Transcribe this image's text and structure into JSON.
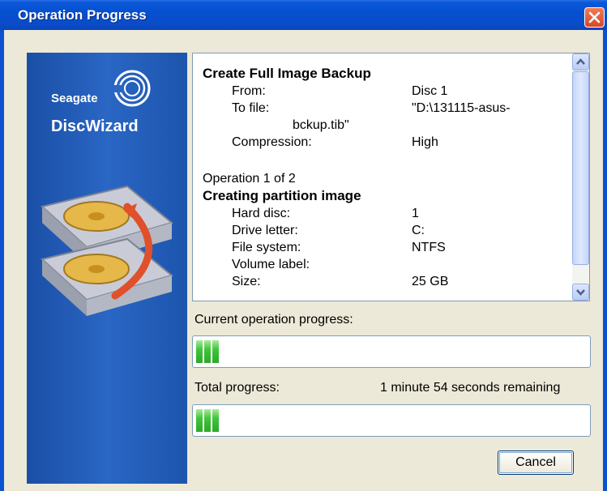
{
  "window": {
    "title": "Operation Progress"
  },
  "banner": {
    "brand": "Seagate",
    "product": "DiscWizard"
  },
  "details": {
    "heading": "Create Full Image Backup",
    "from_label": "From:",
    "from_value": "Disc 1",
    "tofile_label": "To file:",
    "tofile_value": "\"D:\\131115-asus-",
    "tofile_value_cont": "bckup.tib\"",
    "compression_label": "Compression:",
    "compression_value": "High",
    "operation": "Operation 1 of 2",
    "subheading": "Creating partition image",
    "harddisc_label": "Hard disc:",
    "harddisc_value": "1",
    "driveletter_label": "Drive letter:",
    "driveletter_value": "C:",
    "filesystem_label": "File system:",
    "filesystem_value": "NTFS",
    "volumelabel_label": "Volume label:",
    "size_label": "Size:",
    "size_value": "25 GB"
  },
  "current_progress": {
    "label": "Current operation progress:",
    "percent": 10
  },
  "total_progress": {
    "label": "Total progress:",
    "remaining": "1 minute 54 seconds remaining",
    "percent": 10
  },
  "buttons": {
    "cancel": "Cancel"
  },
  "icons": {
    "close": "close-icon",
    "scroll_up": "arrow-up-icon",
    "scroll_down": "arrow-down-icon"
  },
  "colors": {
    "titlebar": "#0a54d6",
    "progress_fill": "#2fbf2f",
    "banner": "#1f5bb5",
    "dialog": "#ece9d8"
  }
}
